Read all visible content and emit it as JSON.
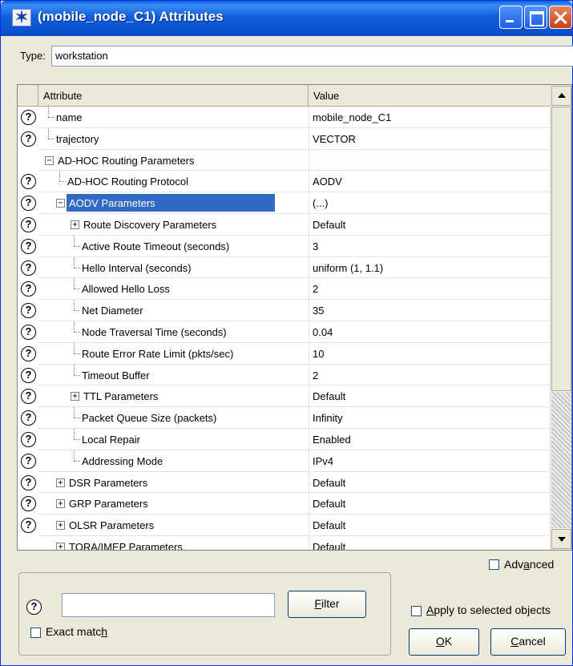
{
  "window": {
    "title": "(mobile_node_C1) Attributes",
    "title_icon": "star-icon"
  },
  "type_field": {
    "label": "Type:",
    "value": "workstation"
  },
  "table": {
    "headers": {
      "attribute": "Attribute",
      "value": "Value"
    },
    "rows": [
      {
        "attr": "name",
        "value": "mobile_node_C1",
        "help": true,
        "indent": 0,
        "toggle": ""
      },
      {
        "attr": "trajectory",
        "value": "VECTOR",
        "help": true,
        "indent": 0,
        "toggle": ""
      },
      {
        "attr": "AD-HOC Routing Parameters",
        "value": "",
        "help": false,
        "indent": 0,
        "toggle": "minus"
      },
      {
        "attr": "AD-HOC Routing Protocol",
        "value": "AODV",
        "help": true,
        "indent": 1,
        "toggle": ""
      },
      {
        "attr": "AODV Parameters",
        "value": "(...)",
        "help": true,
        "indent": 1,
        "toggle": "minus",
        "selected": true
      },
      {
        "attr": "Route Discovery Parameters",
        "value": "Default",
        "help": true,
        "indent": 2,
        "toggle": "plus"
      },
      {
        "attr": "Active Route Timeout (seconds)",
        "value": "3",
        "help": true,
        "indent": 2,
        "toggle": ""
      },
      {
        "attr": "Hello Interval (seconds)",
        "value": "uniform (1, 1.1)",
        "help": true,
        "indent": 2,
        "toggle": ""
      },
      {
        "attr": "Allowed Hello Loss",
        "value": "2",
        "help": true,
        "indent": 2,
        "toggle": ""
      },
      {
        "attr": "Net Diameter",
        "value": "35",
        "help": true,
        "indent": 2,
        "toggle": ""
      },
      {
        "attr": "Node Traversal Time (seconds)",
        "value": "0.04",
        "help": true,
        "indent": 2,
        "toggle": ""
      },
      {
        "attr": "Route Error Rate Limit (pkts/sec)",
        "value": "10",
        "help": true,
        "indent": 2,
        "toggle": ""
      },
      {
        "attr": "Timeout Buffer",
        "value": "2",
        "help": true,
        "indent": 2,
        "toggle": ""
      },
      {
        "attr": "TTL Parameters",
        "value": "Default",
        "help": true,
        "indent": 2,
        "toggle": "plus"
      },
      {
        "attr": "Packet Queue Size (packets)",
        "value": "Infinity",
        "help": true,
        "indent": 2,
        "toggle": ""
      },
      {
        "attr": "Local Repair",
        "value": "Enabled",
        "help": true,
        "indent": 2,
        "toggle": ""
      },
      {
        "attr": "Addressing Mode",
        "value": "IPv4",
        "help": true,
        "indent": 2,
        "toggle": ""
      },
      {
        "attr": "DSR Parameters",
        "value": "Default",
        "help": true,
        "indent": 1,
        "toggle": "plus"
      },
      {
        "attr": "GRP Parameters",
        "value": "Default",
        "help": true,
        "indent": 1,
        "toggle": "plus"
      },
      {
        "attr": "OLSR Parameters",
        "value": "Default",
        "help": true,
        "indent": 1,
        "toggle": "plus"
      },
      {
        "attr": "TORA/IMEP Parameters",
        "value": "Default",
        "help": false,
        "indent": 1,
        "toggle": "plus"
      }
    ]
  },
  "bottom": {
    "filter_input_value": "",
    "filter_button": "Filter",
    "exact_match": "Exact match",
    "advanced": "Advanced",
    "apply_selected": "Apply to selected objects",
    "ok": "OK",
    "cancel": "Cancel"
  },
  "icons": {
    "help": "help-icon",
    "expand": "plus-box-icon",
    "collapse": "minus-box-icon"
  },
  "colors": {
    "titlebar": "#0b54d2",
    "selection": "#316ac5",
    "dialog_bg": "#ece9d8"
  }
}
